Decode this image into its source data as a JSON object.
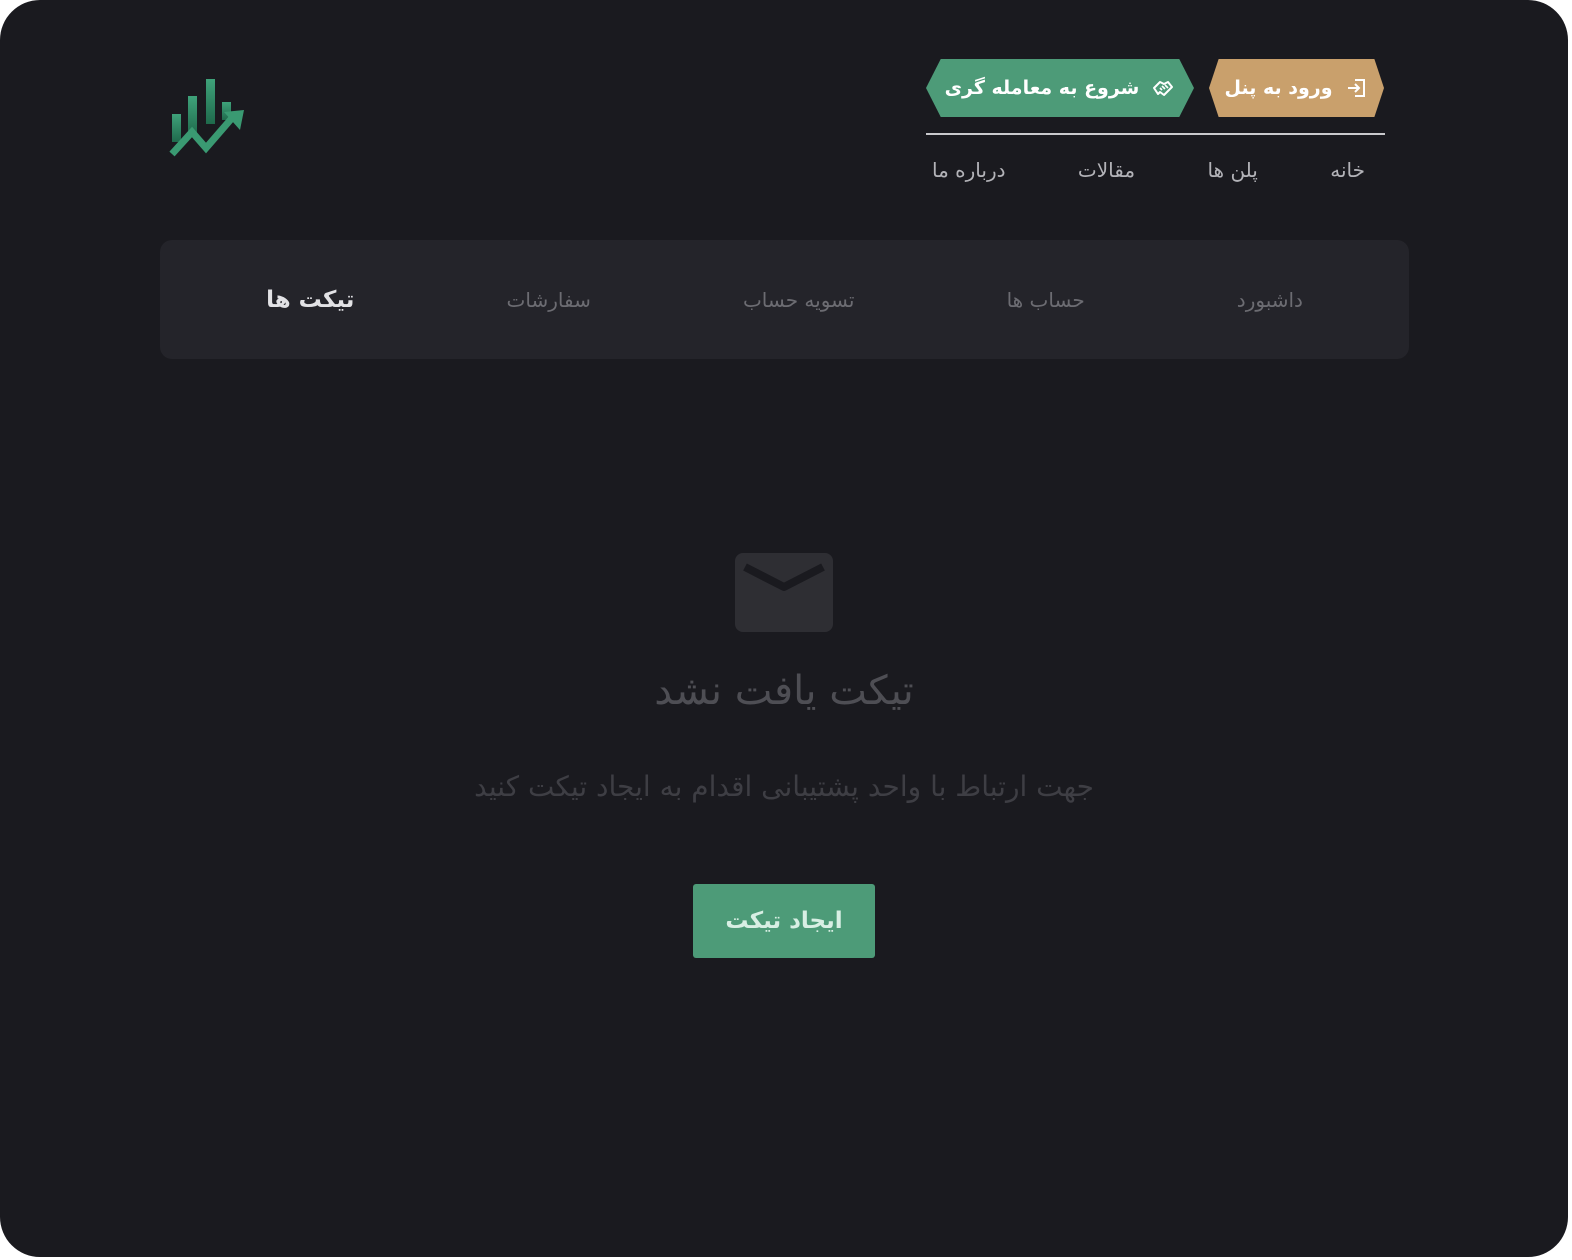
{
  "header": {
    "panel_button": {
      "label": "ورود به پنل",
      "icon": "login-icon",
      "color": "#c9a06c"
    },
    "trade_button": {
      "label": "شروع به معامله گری",
      "icon": "handshake-icon",
      "color": "#4d9b78"
    },
    "nav": [
      {
        "label": "خانه"
      },
      {
        "label": "پلن ها"
      },
      {
        "label": "مقالات"
      },
      {
        "label": "درباره ما"
      }
    ],
    "logo_icon": "chart-growth-logo"
  },
  "tabs": [
    {
      "label": "داشبورد",
      "active": false
    },
    {
      "label": "حساب ها",
      "active": false
    },
    {
      "label": "تسویه حساب",
      "active": false
    },
    {
      "label": "سفارشات",
      "active": false
    },
    {
      "label": "تیکت ها",
      "active": true
    }
  ],
  "empty_state": {
    "icon": "envelope-icon",
    "title": "تیکت یافت نشد",
    "subtitle": "جهت ارتباط با واحد پشتیبانی اقدام به ایجاد تیکت کنید",
    "button_label": "ایجاد تیکت"
  },
  "colors": {
    "background": "#1a1a1f",
    "tabbar": "#24242a",
    "accent_green": "#4d9b78",
    "accent_gold": "#c9a06c"
  }
}
